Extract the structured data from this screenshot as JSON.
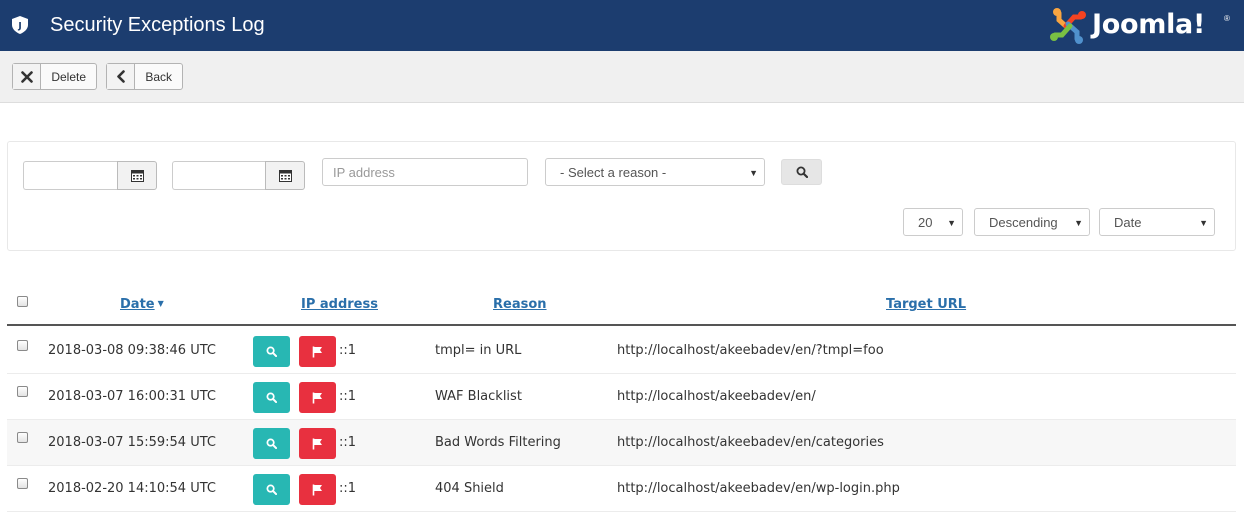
{
  "header": {
    "title": "Security Exceptions Log",
    "brand": "Joomla!",
    "brand_reg": "®"
  },
  "toolbar": {
    "delete_label": "Delete",
    "back_label": "Back"
  },
  "filters": {
    "from_date": "",
    "to_date": "",
    "ip_placeholder": "IP address",
    "reason_selected": "- Select a reason -",
    "limit_selected": "20",
    "direction_selected": "Descending",
    "order_selected": "Date"
  },
  "table": {
    "columns": {
      "date": "Date",
      "ip": "IP address",
      "reason": "Reason",
      "url": "Target URL"
    },
    "sort_column": "date",
    "sort_direction": "descending",
    "rows": [
      {
        "date": "2018-03-08 09:38:46 UTC",
        "ip": "::1",
        "reason": "tmpl= in URL",
        "url": "http://localhost/akeebadev/en/?tmpl=foo"
      },
      {
        "date": "2018-03-07 16:00:31 UTC",
        "ip": "::1",
        "reason": "WAF Blacklist",
        "url": "http://localhost/akeebadev/en/"
      },
      {
        "date": "2018-03-07 15:59:54 UTC",
        "ip": "::1",
        "reason": "Bad Words Filtering",
        "url": "http://localhost/akeebadev/en/categories"
      },
      {
        "date": "2018-02-20 14:10:54 UTC",
        "ip": "::1",
        "reason": "404 Shield",
        "url": "http://localhost/akeebadev/en/wp-login.php"
      }
    ]
  },
  "colors": {
    "header_bg": "#1c3d6f",
    "lookup_button": "#28b7b3",
    "block_button": "#e8303f",
    "link": "#2a6faa"
  },
  "icons": {
    "page": "shield-icon",
    "delete": "close-icon",
    "back": "chevron-left-icon",
    "calendar": "calendar-icon",
    "search": "search-icon",
    "lookup": "search-icon",
    "block": "flag-icon"
  }
}
